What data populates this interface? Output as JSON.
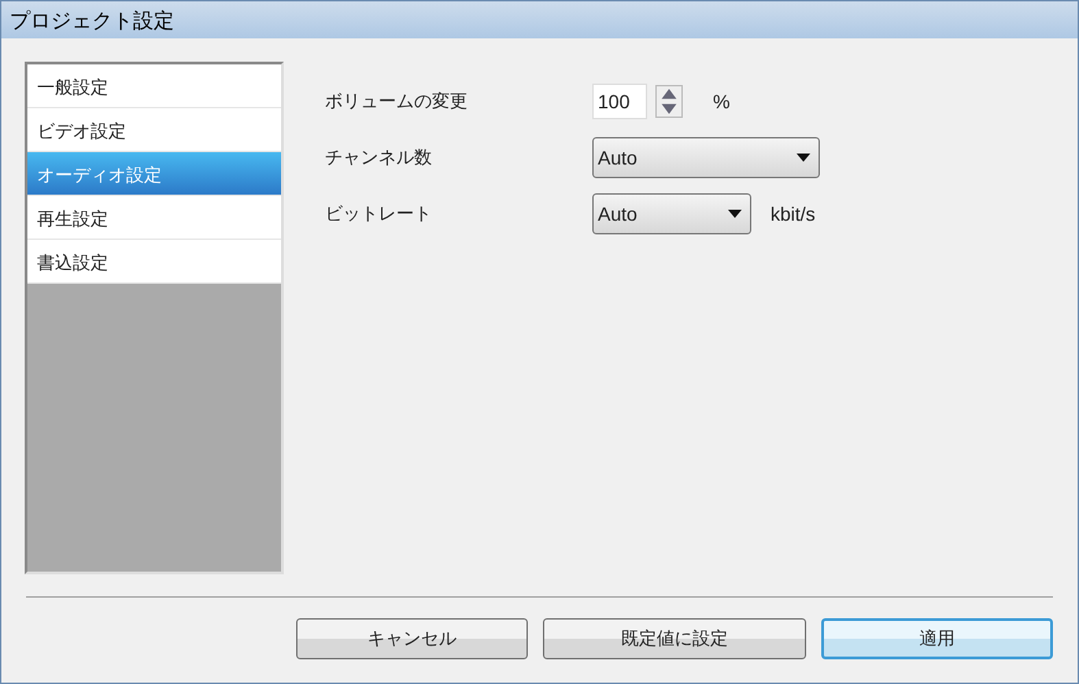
{
  "window": {
    "title": "プロジェクト設定"
  },
  "sidebar": {
    "items": [
      {
        "label": "一般設定",
        "selected": false
      },
      {
        "label": "ビデオ設定",
        "selected": false
      },
      {
        "label": "オーディオ設定",
        "selected": true
      },
      {
        "label": "再生設定",
        "selected": false
      },
      {
        "label": "書込設定",
        "selected": false
      }
    ]
  },
  "settings": [
    {
      "kind": "spinner",
      "label": "ボリュームの変更",
      "value": "100",
      "unit": "%"
    },
    {
      "kind": "dropdown",
      "label": "チャンネル数",
      "value": "Auto"
    },
    {
      "kind": "dropdown",
      "label": "ビットレート",
      "value": "Auto",
      "unit": "kbit/s"
    }
  ],
  "buttons": [
    {
      "label": "キャンセル",
      "default": false
    },
    {
      "label": "既定値に設定",
      "default": false
    },
    {
      "label": "適用",
      "default": true
    }
  ]
}
